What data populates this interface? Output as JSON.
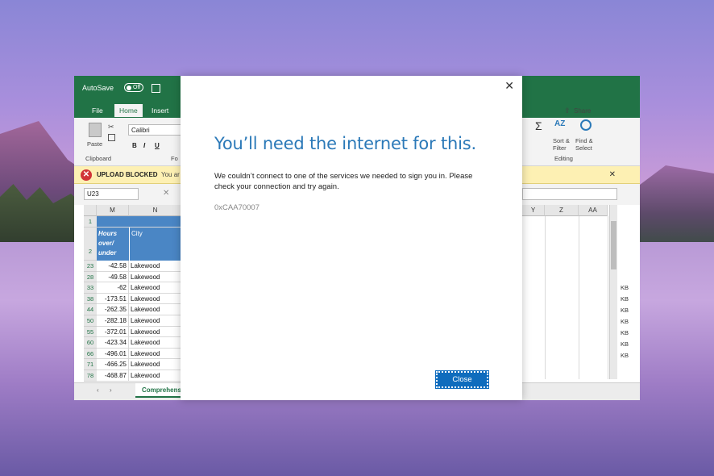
{
  "excel": {
    "autosave_label": "AutoSave",
    "autosave_state": "Off",
    "tabs": [
      "File",
      "Home",
      "Insert"
    ],
    "active_tab": "Home",
    "clipboard": {
      "paste_label": "Paste",
      "group_label": "Clipboard"
    },
    "font": {
      "name": "Calibri",
      "bold": "B",
      "italic": "I",
      "underline": "U",
      "group_label_partial": "Fo"
    },
    "share_label": "Share",
    "sort_filter_label": "Sort & Filter",
    "find_select_label": "Find & Select",
    "editing_label": "Editing",
    "error_bar": {
      "title": "UPLOAD BLOCKED",
      "text_partial": "You ar"
    },
    "name_box": "U23",
    "columns_left": [
      "M",
      "N"
    ],
    "columns_right": [
      "Y",
      "Z",
      "AA"
    ],
    "header_row_num": "1",
    "table_header_row": "2",
    "header_m": "Hours over/ under",
    "header_n": "City",
    "rows": [
      {
        "num": "23",
        "m": "-42.58",
        "n": "Lakewood"
      },
      {
        "num": "28",
        "m": "-49.58",
        "n": "Lakewood"
      },
      {
        "num": "33",
        "m": "-62",
        "n": "Lakewood"
      },
      {
        "num": "38",
        "m": "-173.51",
        "n": "Lakewood"
      },
      {
        "num": "44",
        "m": "-262.35",
        "n": "Lakewood"
      },
      {
        "num": "50",
        "m": "-282.18",
        "n": "Lakewood"
      },
      {
        "num": "55",
        "m": "-372.01",
        "n": "Lakewood"
      },
      {
        "num": "60",
        "m": "-423.34",
        "n": "Lakewood"
      },
      {
        "num": "66",
        "m": "-496.01",
        "n": "Lakewood"
      },
      {
        "num": "71",
        "m": "-466.25",
        "n": "Lakewood"
      },
      {
        "num": "78",
        "m": "-468.87",
        "n": "Lakewood"
      }
    ],
    "kb_labels": [
      "KB",
      "KB",
      "KB",
      "KB",
      "KB",
      "KB",
      "KB"
    ],
    "sheet_tab": "Comprehens"
  },
  "dialog": {
    "title": "You’ll need the internet for this.",
    "body": "We couldn’t connect to one of the services we needed to sign you in. Please check your connection and try again.",
    "error_code": "0xCAA70007",
    "close_button": "Close"
  }
}
